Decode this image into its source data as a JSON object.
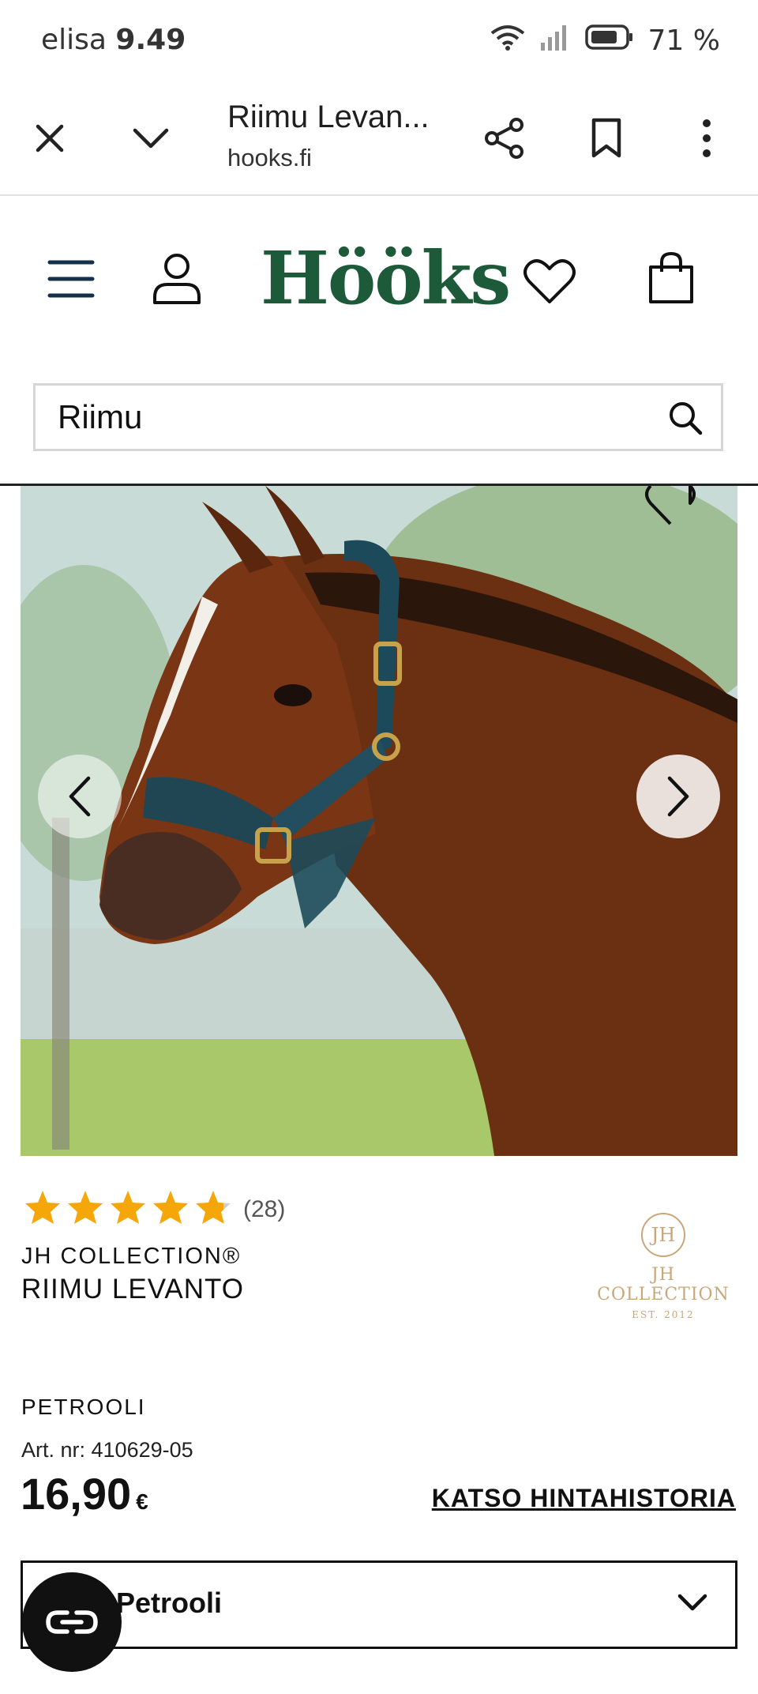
{
  "status_bar": {
    "carrier": "elisa",
    "time": "9.49",
    "battery": "71 %"
  },
  "browser": {
    "page_title": "Riimu Levan...",
    "url": "hooks.fi"
  },
  "site": {
    "logo_text": "Hööks",
    "brand_color": "#1d5a3a"
  },
  "search": {
    "value": "Riimu"
  },
  "product": {
    "rating_count": "(28)",
    "rating_value": 4.8,
    "brand": "JH COLLECTION®",
    "name": "RIIMU LEVANTO",
    "brand_logo": {
      "monogram": "JH",
      "name": "JH COLLECTION",
      "est": "EST. 2012"
    },
    "color_name": "PETROOLI",
    "art_nr": "Art. nr: 410629-05",
    "price": "16,90",
    "currency": "€",
    "price_history_link": "KATSO HINTAHISTORIA",
    "selected_variant": "Petrooli",
    "star_color": "#f5a70a"
  }
}
